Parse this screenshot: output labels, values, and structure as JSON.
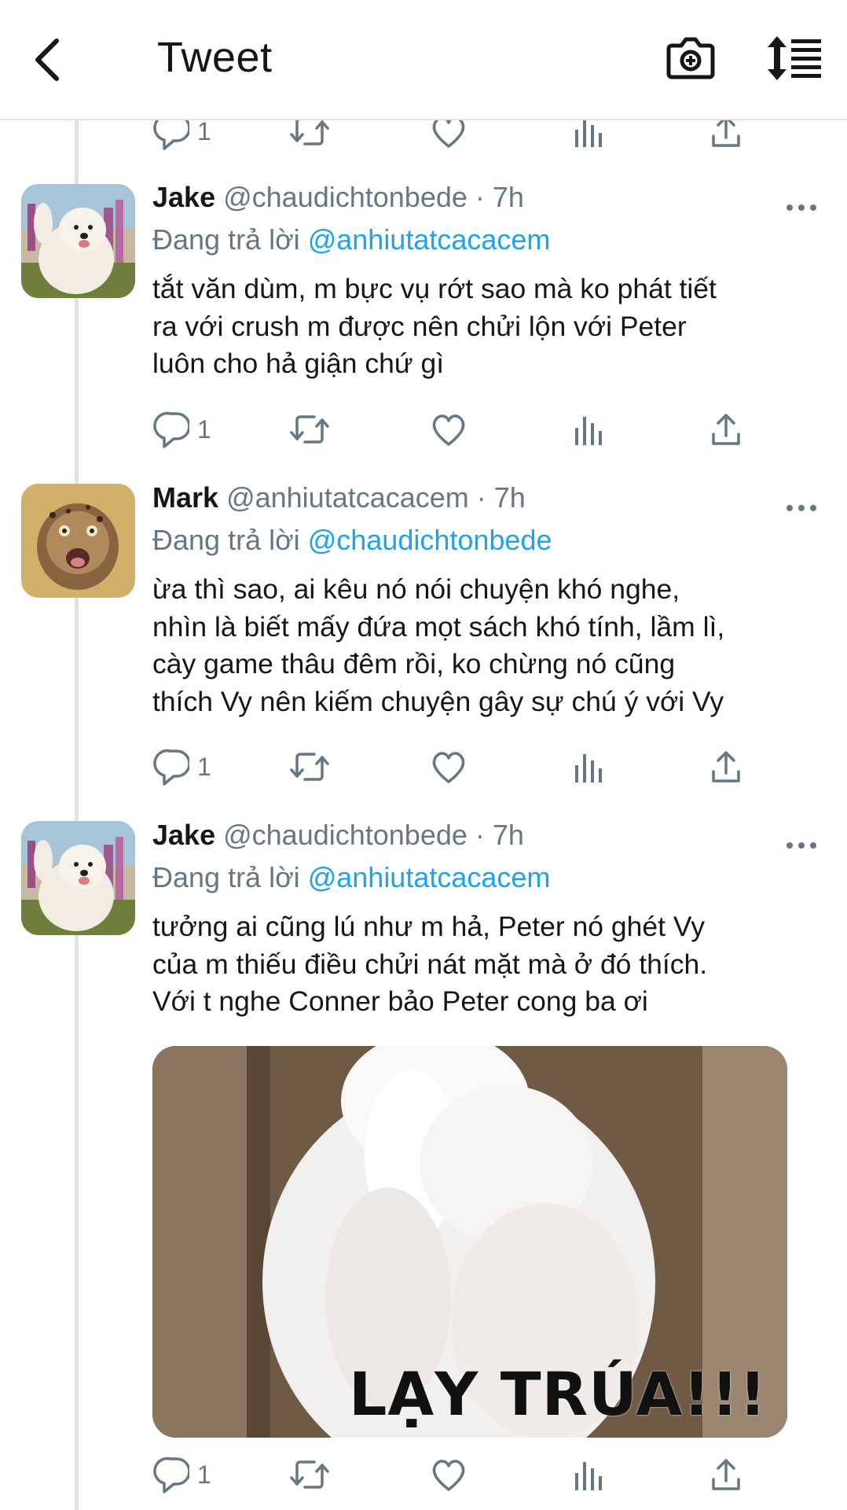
{
  "header": {
    "title": "Tweet",
    "back_icon": "chevron-left-icon",
    "camera_icon": "camera-add-icon",
    "sort_icon": "sort-list-icon"
  },
  "colors": {
    "accent": "#1da1f2",
    "secondary_text": "#657786",
    "primary_text": "#14171a"
  },
  "top_actions": {
    "reply_count": "1"
  },
  "tweets": [
    {
      "name": "Jake",
      "handle": "@chaudichtonbede · 7h",
      "reply_prefix": "Đang trả lời",
      "reply_to": "@anhiutatcacacem",
      "text": "tắt văn dùm, m bực vụ rớt sao mà ko phát tiết\nra với crush m được nên chửi lộn với Peter\nluôn cho hả giận chứ gì",
      "reply_count": "1"
    },
    {
      "name": "Mark",
      "handle": "@anhiutatcacacem · 7h",
      "reply_prefix": "Đang trả lời",
      "reply_to": "@chaudichtonbede",
      "text": "ừa thì sao, ai kêu nó nói chuyện khó nghe,\nnhìn là biết mấy đứa mọt sách khó tính, lầm lì,\ncày game thâu đêm rồi, ko chừng nó cũng\nthích Vy nên kiếm chuyện gây sự chú ý với Vy",
      "reply_count": "1"
    },
    {
      "name": "Jake",
      "handle": "@chaudichtonbede · 7h",
      "reply_prefix": "Đang trả lời",
      "reply_to": "@anhiutatcacacem",
      "text": "tưởng ai cũng lú như m hả, Peter nó ghét Vy\ncủa m thiếu điều chửi nát mặt mà ở đó thích.\nVới t nghe Conner bảo Peter cong ba ơi",
      "media_caption": "LẠY TRÚA!!!",
      "reply_count": "1"
    }
  ]
}
